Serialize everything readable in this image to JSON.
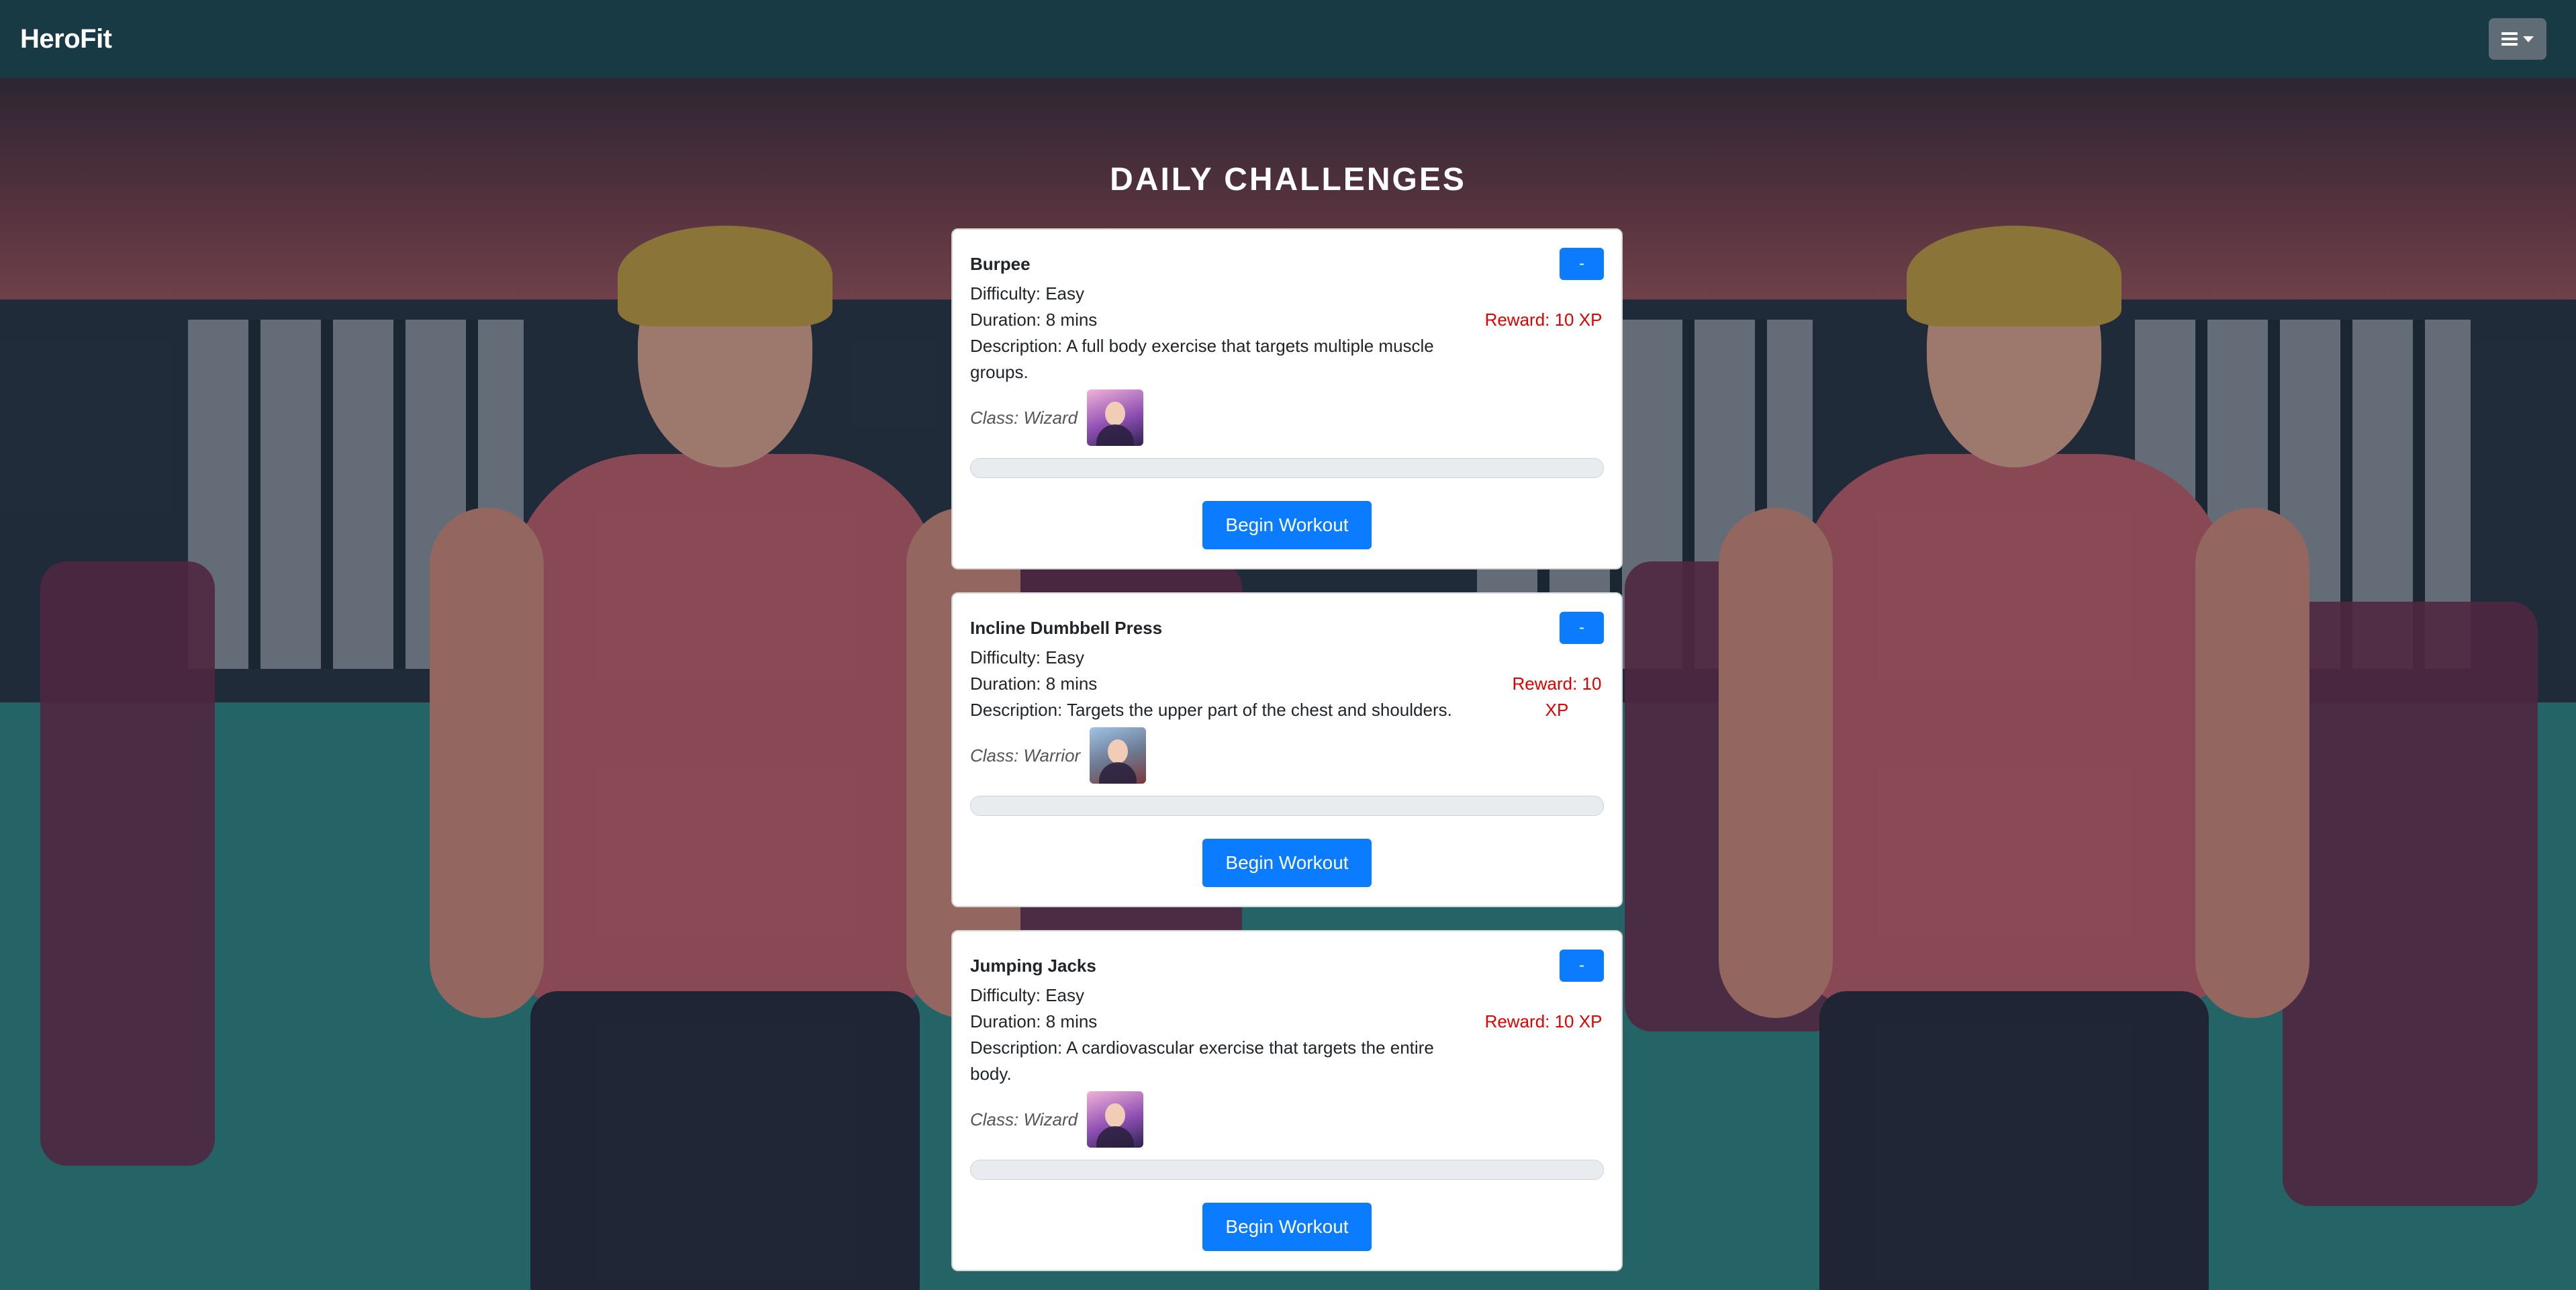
{
  "brand": "HeroFit",
  "menu_icon": "hamburger-icon",
  "page_title": "DAILY CHALLENGES",
  "collapse_label": "-",
  "challenges": [
    {
      "title": "Burpee",
      "difficulty": "Difficulty: Easy",
      "duration": "Duration: 8 mins",
      "description": "Description: A full body exercise that targets multiple muscle groups.",
      "class": "Class: Wizard",
      "reward": "Reward: 10 XP",
      "progress": 0,
      "button": "Begin Workout"
    },
    {
      "title": "Incline Dumbbell Press",
      "difficulty": "Difficulty: Easy",
      "duration": "Duration: 8 mins",
      "description": "Description: Targets the upper part of the chest and shoulders.",
      "class": "Class: Warrior",
      "reward": "Reward: 10 XP",
      "progress": 0,
      "button": "Begin Workout"
    },
    {
      "title": "Jumping Jacks",
      "difficulty": "Difficulty: Easy",
      "duration": "Duration: 8 mins",
      "description": "Description: A cardiovascular exercise that targets the entire body.",
      "class": "Class: Wizard",
      "reward": "Reward: 10 XP",
      "progress": 0,
      "button": "Begin Workout"
    }
  ],
  "colors": {
    "navbar": "#183a44",
    "accent": "#0b7bff",
    "reward": "#e00000"
  }
}
